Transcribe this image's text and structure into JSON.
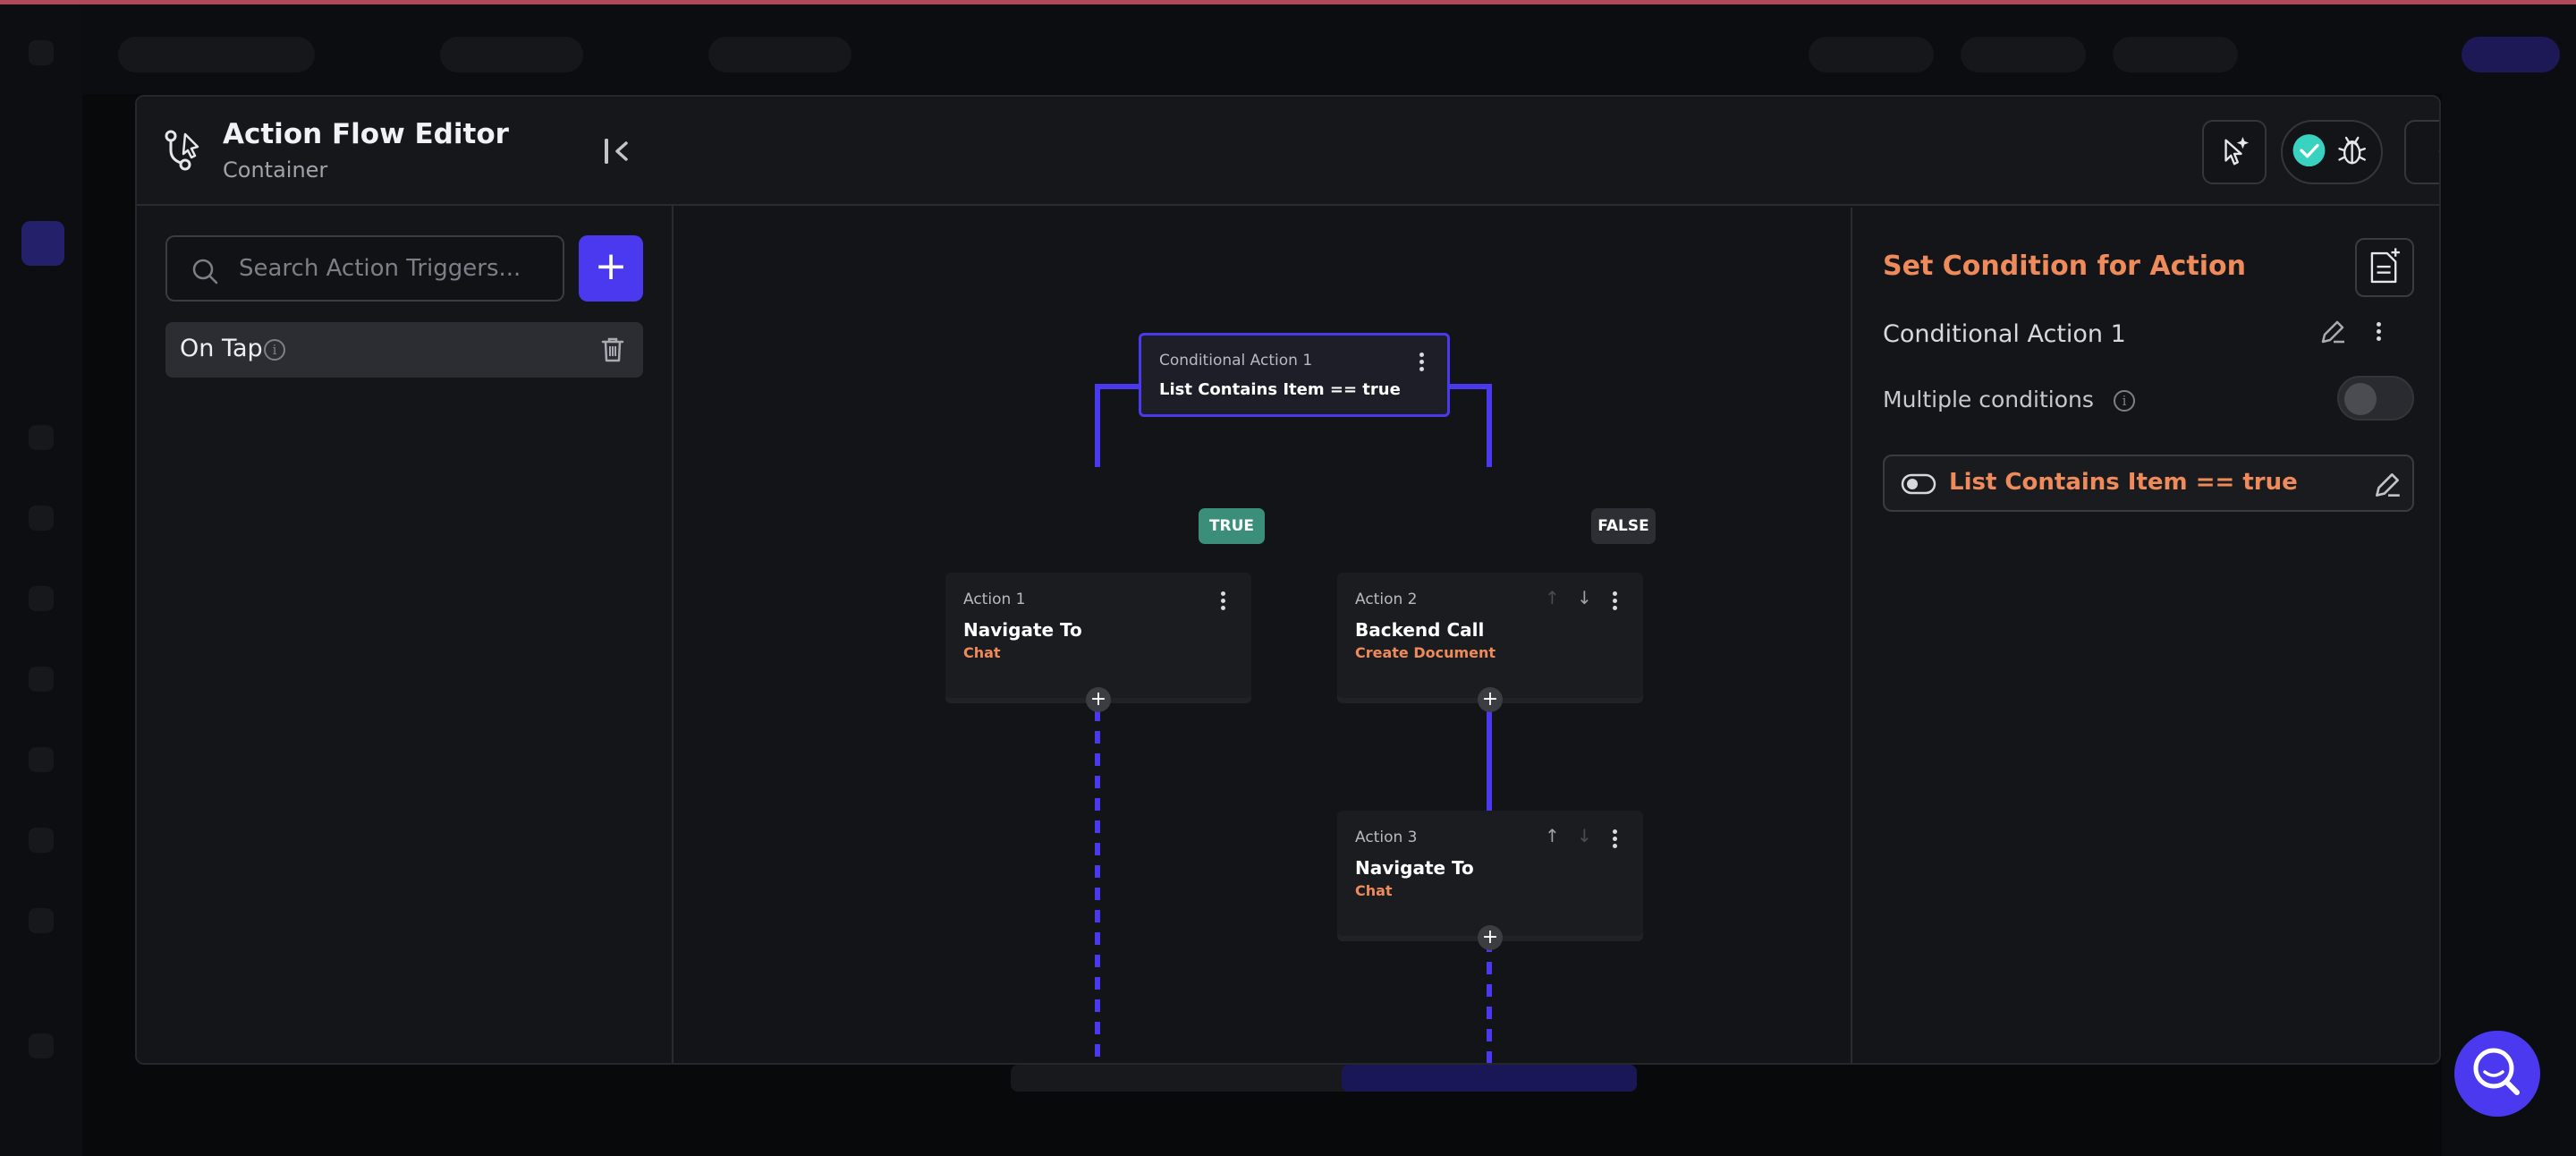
{
  "header": {
    "title": "Action Flow Editor",
    "subtitle": "Container",
    "close_label": "Close"
  },
  "left_panel": {
    "search_placeholder": "Search Action Triggers...",
    "add_label": "+",
    "triggers": [
      {
        "label": "On Tap"
      }
    ]
  },
  "flow": {
    "conditional": {
      "caption": "Conditional Action 1",
      "expression": "List Contains Item  ==  true"
    },
    "true_label": "TRUE",
    "false_label": "FALSE",
    "actions": [
      {
        "caption": "Action 1",
        "title": "Navigate To",
        "subtitle": "Chat"
      },
      {
        "caption": "Action 2",
        "title": "Backend Call",
        "subtitle": "Create Document"
      },
      {
        "caption": "Action 3",
        "title": "Navigate To",
        "subtitle": "Chat"
      }
    ],
    "plus_label": "+"
  },
  "right_panel": {
    "title": "Set Condition for Action",
    "action_name": "Conditional Action 1",
    "multiple_conditions_label": "Multiple conditions",
    "multiple_conditions_enabled": false,
    "condition_expression": "List Contains Item  ==  true"
  },
  "colors": {
    "accent": "#4b39ef",
    "orange": "#ef8b5a",
    "true_badge": "#3b8f7a",
    "false_badge": "#2d2e33",
    "check_green": "#39d2c0"
  }
}
